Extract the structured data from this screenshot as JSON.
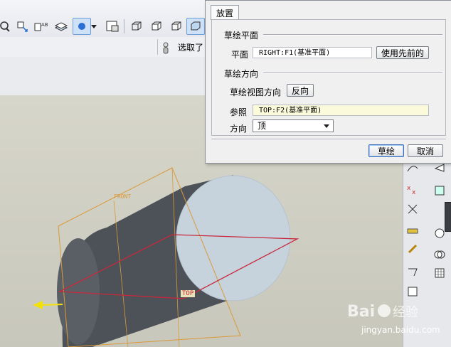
{
  "toolbar": {
    "status_hint": "选取了"
  },
  "dialog": {
    "tab_label": "放置",
    "sketch_plane": {
      "group_title": "草绘平面",
      "plane_label": "平面",
      "plane_value": "RIGHT:F1(基准平面)",
      "use_previous_button": "使用先前的"
    },
    "sketch_orientation": {
      "group_title": "草绘方向",
      "view_direction_label": "草绘视图方向",
      "flip_button": "反向",
      "reference_label": "参照",
      "reference_value": "TOP:F2(基准平面)",
      "orientation_label": "方向",
      "orientation_value": "顶"
    },
    "sketch_button": "草绘",
    "cancel_button": "取消"
  },
  "canvas": {
    "datum_front_label": "FRONT",
    "datum_top_label": "TOP"
  },
  "watermark": {
    "text": "jingyan.baidu.com"
  },
  "colors": {
    "accent_blue": "#2a6fd6",
    "datum_orange": "#d99a3a",
    "sketch_red": "#c8283c",
    "arrow_yellow": "#f2e20a",
    "cylinder_dark": "#4d5258",
    "cylinder_face": "#c6d3dd"
  }
}
